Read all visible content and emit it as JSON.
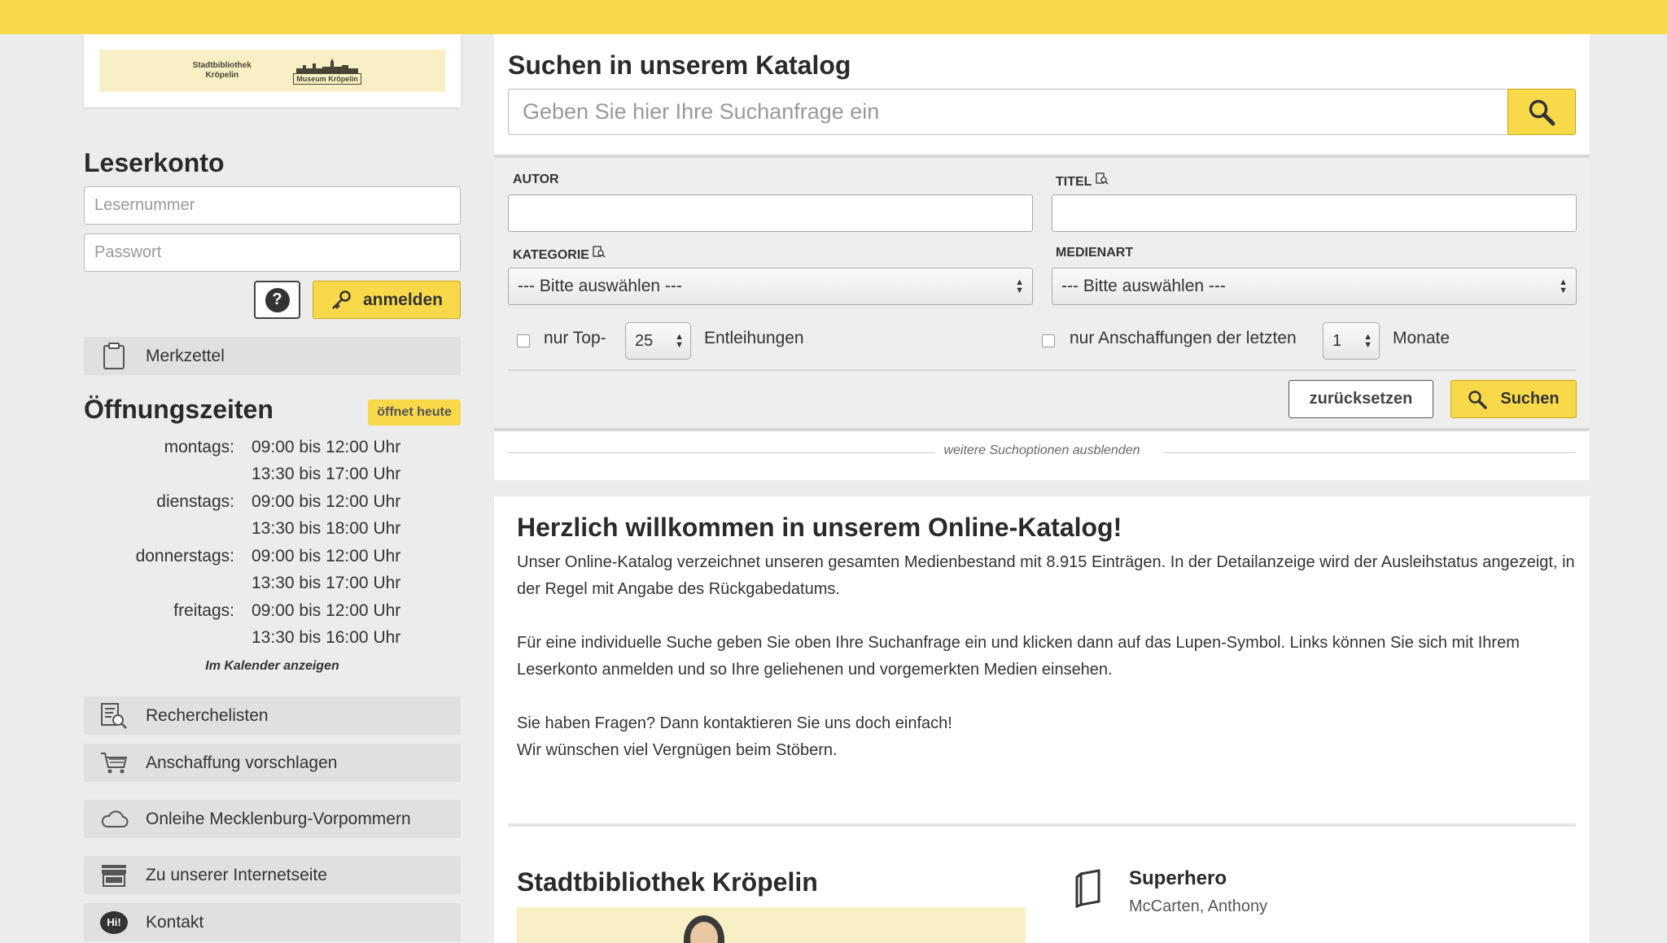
{
  "logo": {
    "library_name": "Stadtbibliothek Kröpelin",
    "museum_name": "Museum Kröpelin"
  },
  "account": {
    "heading": "Leserkonto",
    "reader_number_placeholder": "Lesernummer",
    "password_placeholder": "Passwort",
    "help_label": "?",
    "login_label": "anmelden"
  },
  "sidebar": {
    "merkzettel": "Merkzettel",
    "recherchelisten": "Recherchelisten",
    "anschaffung": "Anschaffung vorschlagen",
    "onleihe": "Onleihe Mecklenburg-Vorpommern",
    "internetseite": "Zu unserer Internetseite",
    "kontakt": "Kontakt",
    "kontakt_icon_text": "Hi!"
  },
  "hours": {
    "heading": "Öffnungszeiten",
    "badge": "öffnet heute",
    "rows": [
      {
        "day": "montags:",
        "time": "09:00 bis 12:00 Uhr"
      },
      {
        "day": "",
        "time": "13:30 bis 17:00 Uhr"
      },
      {
        "day": "dienstags:",
        "time": "09:00 bis 12:00 Uhr"
      },
      {
        "day": "",
        "time": "13:30 bis 18:00 Uhr"
      },
      {
        "day": "donnerstags:",
        "time": "09:00 bis 12:00 Uhr"
      },
      {
        "day": "",
        "time": "13:30 bis 17:00 Uhr"
      },
      {
        "day": "freitags:",
        "time": "09:00 bis 12:00 Uhr"
      },
      {
        "day": "",
        "time": "13:30 bis 16:00 Uhr"
      }
    ],
    "calendar_link": "Im Kalender anzeigen"
  },
  "search": {
    "heading": "Suchen in unserem Katalog",
    "placeholder": "Geben Sie hier Ihre Suchanfrage ein"
  },
  "advanced": {
    "autor_label": "AUTOR",
    "titel_label": "TITEL",
    "kategorie_label": "KATEGORIE",
    "medienart_label": "MEDIENART",
    "kategorie_value": "--- Bitte auswählen ---",
    "medienart_value": "--- Bitte auswählen ---",
    "top_prefix": "nur Top-",
    "top_value": "25",
    "top_suffix": "Entleihungen",
    "acq_prefix": "nur Anschaffungen der letzten",
    "acq_value": "1",
    "acq_suffix": "Monate",
    "reset_label": "zurücksetzen",
    "search_label": "Suchen",
    "hide_options": "weitere Suchoptionen ausblenden"
  },
  "welcome": {
    "title": "Herzlich willkommen in unserem Online-Katalog!",
    "p1": "Unser Online-Katalog verzeichnet unseren gesamten Medienbestand mit 8.915 Einträgen. In der Detailanzeige wird der Ausleihstatus angezeigt, in der Regel mit Angabe des Rückgabedatums.",
    "p2": "Für eine individuelle Suche geben Sie oben Ihre Suchanfrage ein und klicken dann auf das Lupen-Symbol. Links können Sie sich mit Ihrem Leserkonto anmelden und so Ihre geliehenen und vorgemerkten Medien einsehen.",
    "p3a": "Sie haben Fragen? Dann kontaktieren Sie uns doch einfach!",
    "p3b": "Wir wünschen viel Vergnügen beim Stöbern.",
    "library_heading": "Stadtbibliothek Kröpelin",
    "book_title": "Superhero",
    "book_author": "McCarten, Anthony"
  },
  "colors": {
    "accent": "#f8d94a",
    "background": "#ececec"
  }
}
